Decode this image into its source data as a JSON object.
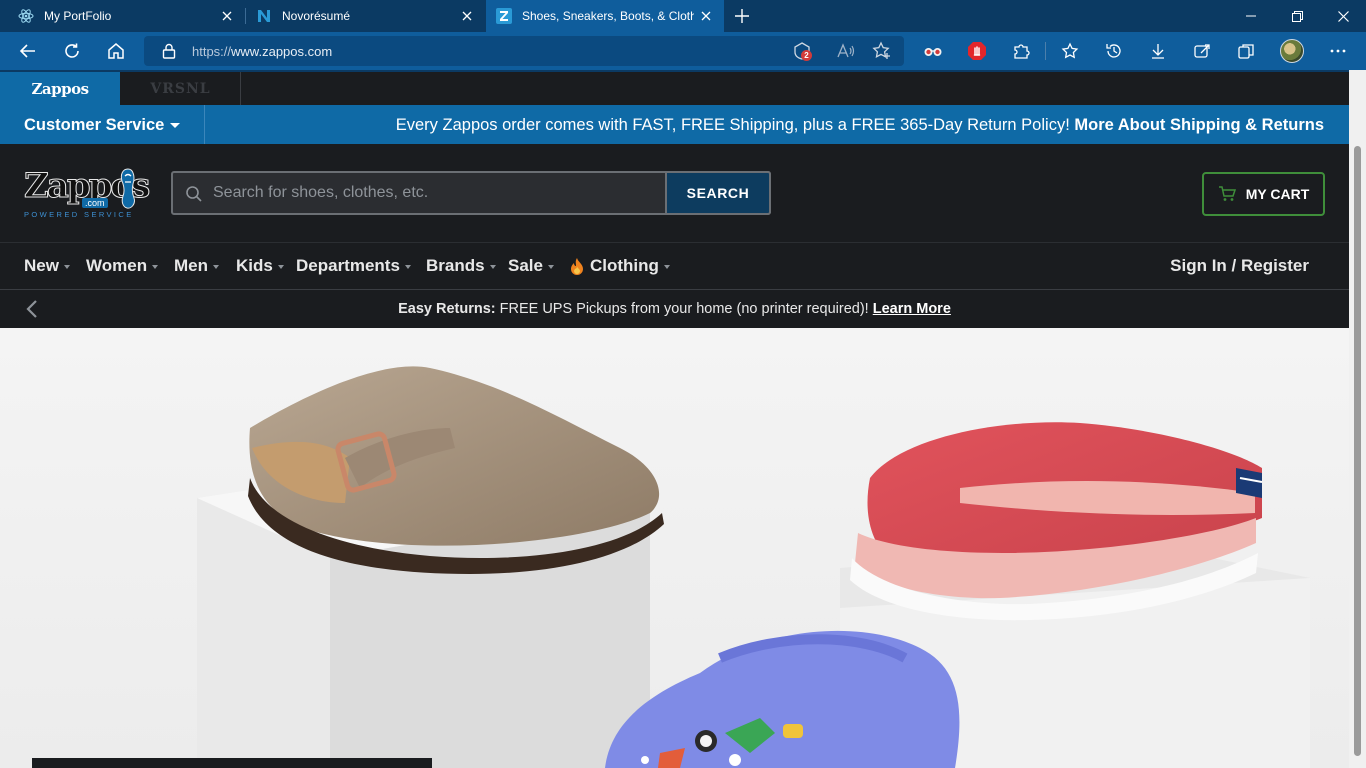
{
  "browser": {
    "tabs": [
      {
        "title": "My PortFolio",
        "icon": "react-icon",
        "active": false
      },
      {
        "title": "Novorésumé",
        "icon": "novoresume-icon",
        "active": false
      },
      {
        "title": "Shoes, Sneakers, Boots, & Clothing",
        "icon": "zappos-z-icon",
        "active": true
      }
    ],
    "url_proto": "https://",
    "url_host": "www.zappos.com",
    "tracking_badge_count": "2"
  },
  "site": {
    "brand_tabs": [
      {
        "label": "Zappos",
        "active": true
      },
      {
        "label": "VRSNL",
        "active": false
      }
    ],
    "customer_service": "Customer Service",
    "promo_text": "Every Zappos order comes with FAST, FREE Shipping, plus a FREE 365-Day Return Policy!",
    "promo_link": "More About Shipping & Returns",
    "logo": {
      "word": "Zappos",
      "dotcom": ".com",
      "tagline": "POWERED SERVICE"
    },
    "search": {
      "placeholder": "Search for shoes, clothes, etc.",
      "value": "",
      "button": "SEARCH"
    },
    "cart_label": "MY CART",
    "nav": [
      {
        "label": "New"
      },
      {
        "label": "Women"
      },
      {
        "label": "Men"
      },
      {
        "label": "Kids"
      },
      {
        "label": "Departments"
      },
      {
        "label": "Brands"
      },
      {
        "label": "Sale"
      },
      {
        "label": "Clothing",
        "icon": "fire-icon"
      }
    ],
    "sign_in": "Sign In / Register",
    "returns": {
      "bold": "Easy Returns:",
      "text": " FREE UPS Pickups from your home (no printer required)! ",
      "link": "Learn More"
    }
  },
  "colors": {
    "browser_frame": "#0b3a63",
    "browser_active": "#0f5d9c",
    "site_blue": "#0f6aa6",
    "site_dark": "#1a1c1f",
    "cart_green": "#3f8e3a"
  }
}
